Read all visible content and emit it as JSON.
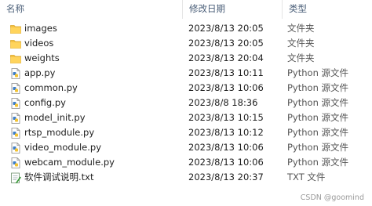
{
  "header": {
    "name": "名称",
    "date": "修改日期",
    "type": "类型",
    "sort_caret": "^"
  },
  "files": [
    {
      "name": "images",
      "date": "2023/8/13 20:05",
      "type": "文件夹",
      "icon": "folder-icon"
    },
    {
      "name": "videos",
      "date": "2023/8/13 20:05",
      "type": "文件夹",
      "icon": "folder-icon"
    },
    {
      "name": "weights",
      "date": "2023/8/13 20:04",
      "type": "文件夹",
      "icon": "folder-icon"
    },
    {
      "name": "app.py",
      "date": "2023/8/13 10:11",
      "type": "Python 源文件",
      "icon": "python-file-icon"
    },
    {
      "name": "common.py",
      "date": "2023/8/13 10:06",
      "type": "Python 源文件",
      "icon": "python-file-icon"
    },
    {
      "name": "config.py",
      "date": "2023/8/8 18:36",
      "type": "Python 源文件",
      "icon": "python-file-icon"
    },
    {
      "name": "model_init.py",
      "date": "2023/8/13 10:15",
      "type": "Python 源文件",
      "icon": "python-file-icon"
    },
    {
      "name": "rtsp_module.py",
      "date": "2023/8/13 10:12",
      "type": "Python 源文件",
      "icon": "python-file-icon"
    },
    {
      "name": "video_module.py",
      "date": "2023/8/13 10:06",
      "type": "Python 源文件",
      "icon": "python-file-icon"
    },
    {
      "name": "webcam_module.py",
      "date": "2023/8/13 10:06",
      "type": "Python 源文件",
      "icon": "python-file-icon"
    },
    {
      "name": "软件调试说明.txt",
      "date": "2023/8/13 20:37",
      "type": "TXT 文件",
      "icon": "text-file-icon"
    }
  ],
  "watermark": "CSDN @goomind",
  "colors": {
    "folder": "#f5c242",
    "python_blue": "#3f7ec6",
    "header_text": "#4c607a",
    "text_file_green": "#3a9b3a"
  }
}
